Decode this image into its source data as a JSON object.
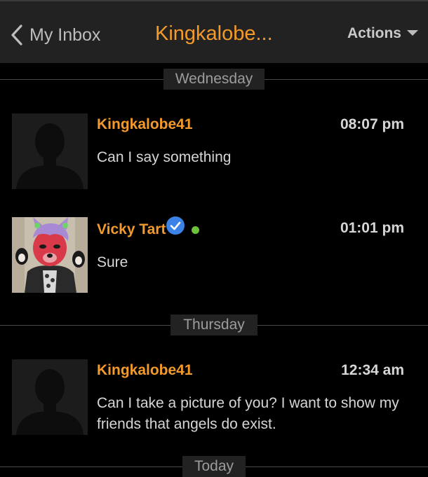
{
  "header": {
    "back_label": "My Inbox",
    "title": "Kingkalobe...",
    "actions_label": "Actions"
  },
  "separators": {
    "wednesday": "Wednesday",
    "thursday": "Thursday",
    "today": "Today"
  },
  "messages": [
    {
      "sender": "Kingkalobe41",
      "time": "08:07 pm",
      "text": "Can I say something"
    },
    {
      "sender": "Vicky Tart",
      "time": "01:01 pm",
      "text": "Sure",
      "verified": true,
      "online": true
    },
    {
      "sender": "Kingkalobe41",
      "time": "12:34 am",
      "text": "Can I take a picture of you? I want to show my friends that angels do exist."
    }
  ],
  "colors": {
    "accent": "#f39a2b",
    "header_bg": "#222222",
    "verified": "#3b82e6",
    "online": "#6cc23a"
  },
  "icons": {
    "back": "chevron-left-icon",
    "actions": "caret-down-icon",
    "verified": "verified-check-icon",
    "online": "online-dot-icon",
    "default_avatar": "default-avatar-icon"
  }
}
